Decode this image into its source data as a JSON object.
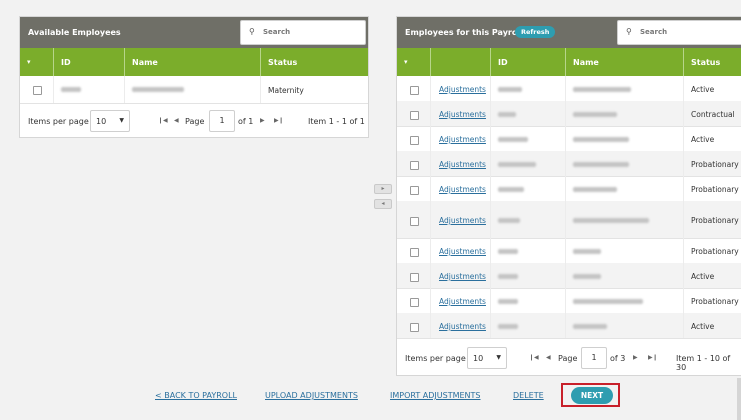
{
  "left_panel": {
    "title": "Available Employees",
    "search_placeholder": "Search",
    "columns": {
      "id": "ID",
      "name": "Name",
      "status": "Status"
    },
    "rows": [
      {
        "status": "Maternity"
      }
    ],
    "pager": {
      "items_per_page_label": "Items per page",
      "page_size": "10",
      "page_label": "Page",
      "page": "1",
      "of_label": "of 1",
      "range_label": "Item 1 - 1 of 1"
    }
  },
  "right_panel": {
    "title": "Employees for this Payroll",
    "refresh_label": "Refresh",
    "search_placeholder": "Search",
    "columns": {
      "id": "ID",
      "name": "Name",
      "status": "Status"
    },
    "rows": [
      {
        "link": "Adjustments",
        "status": "Active"
      },
      {
        "link": "Adjustments",
        "status": "Contractual"
      },
      {
        "link": "Adjustments",
        "status": "Active"
      },
      {
        "link": "Adjustments",
        "status": "Probationary"
      },
      {
        "link": "Adjustments",
        "status": "Probationary"
      },
      {
        "link": "Adjustments",
        "status": "Probationary"
      },
      {
        "link": "Adjustments",
        "status": "Probationary"
      },
      {
        "link": "Adjustments",
        "status": "Active"
      },
      {
        "link": "Adjustments",
        "status": "Probationary"
      },
      {
        "link": "Adjustments",
        "status": "Active"
      }
    ],
    "pager": {
      "items_per_page_label": "Items per page",
      "page_size": "10",
      "page_label": "Page",
      "page": "1",
      "of_label": "of 3",
      "range_label": "Item 1 - 10 of 30"
    }
  },
  "transfer": {
    "right_arrow": "▸",
    "left_arrow": "◂"
  },
  "footer": {
    "back_label": "< BACK TO PAYROLL",
    "upload_label": "UPLOAD ADJUSTMENTS",
    "import_label": "IMPORT ADJUSTMENTS",
    "delete_label": "DELETE",
    "next_label": "NEXT"
  },
  "colors": {
    "header": "#6f6f67",
    "table_header": "#7bad2b",
    "accent": "#2e9db0",
    "highlight": "#c8202a",
    "link": "#2a6f9d"
  },
  "icons": {
    "search": "magnifier-icon",
    "dropdown": "chevron-down-icon",
    "pager_first": "first-page-icon",
    "pager_prev": "prev-page-icon",
    "pager_next": "next-page-icon",
    "pager_last": "last-page-icon"
  }
}
